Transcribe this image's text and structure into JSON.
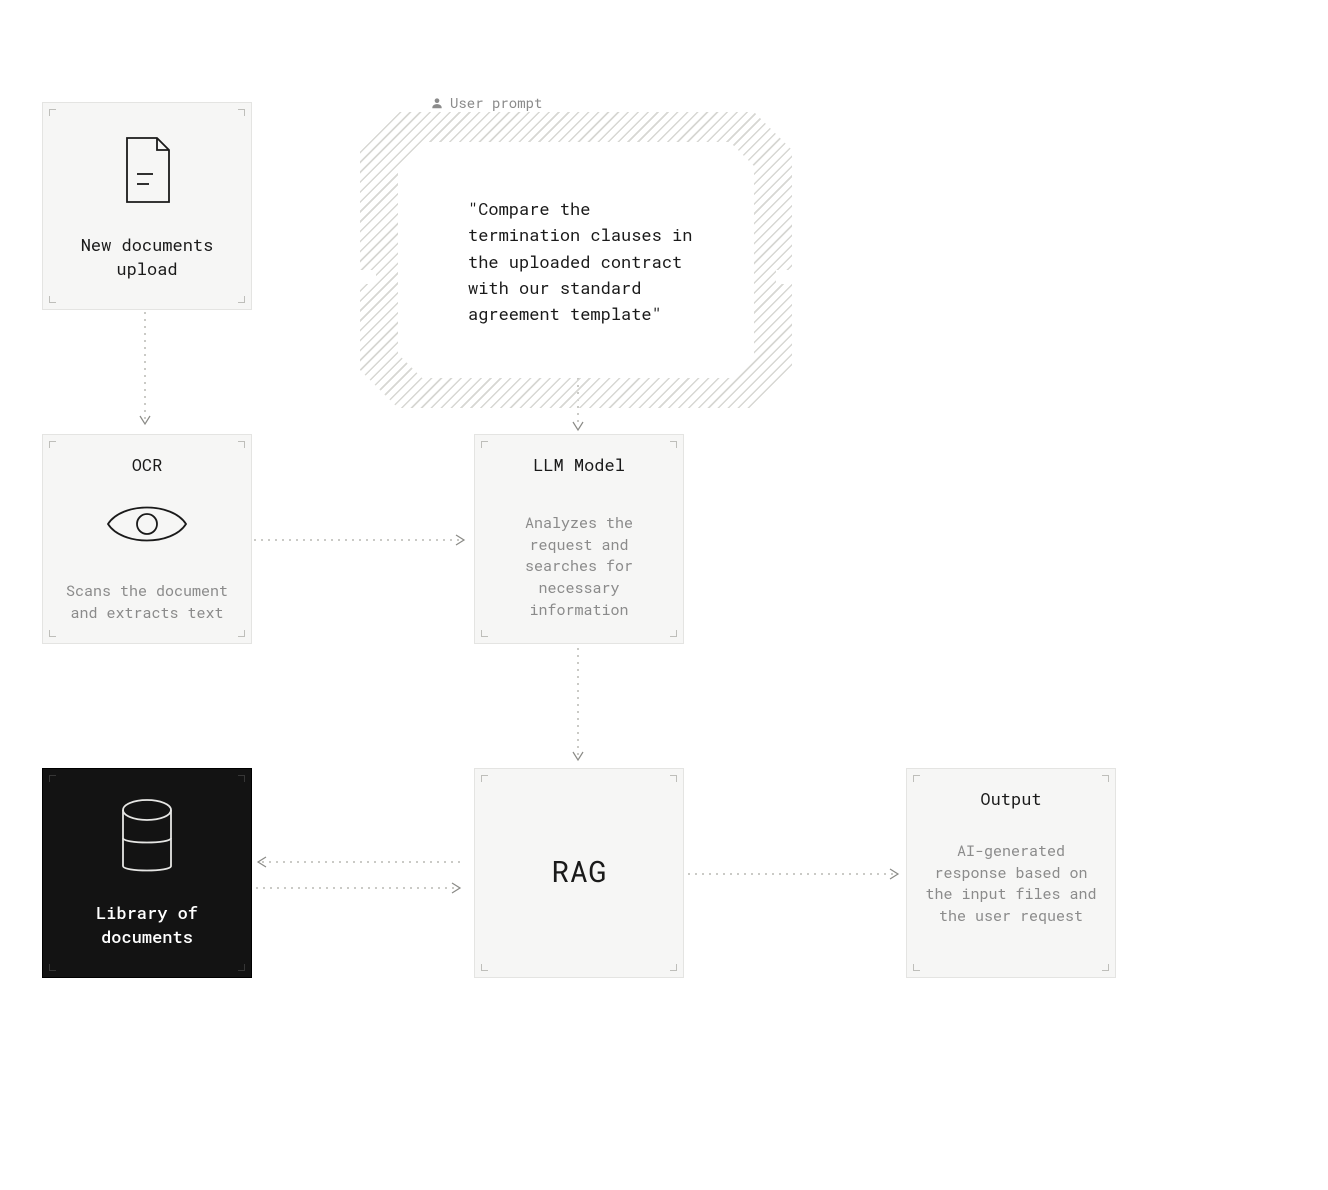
{
  "prompt": {
    "label": "User prompt",
    "text": "\"Compare the termination clauses in the uploaded contract with our standard agreement template\""
  },
  "nodes": {
    "upload": {
      "title": "New documents upload"
    },
    "ocr": {
      "title": "OCR",
      "subtitle": "Scans the document and extracts text"
    },
    "llm": {
      "title": "LLM Model",
      "subtitle": "Analyzes the request and searches for necessary information"
    },
    "library": {
      "title": "Library of documents"
    },
    "rag": {
      "title": "RAG"
    },
    "output": {
      "title": "Output",
      "subtitle": "AI-generated response based on the input files and the user request"
    }
  },
  "icons": {
    "user": "user-icon",
    "doc": "document-icon",
    "eye": "eye-icon",
    "db": "database-icon"
  }
}
